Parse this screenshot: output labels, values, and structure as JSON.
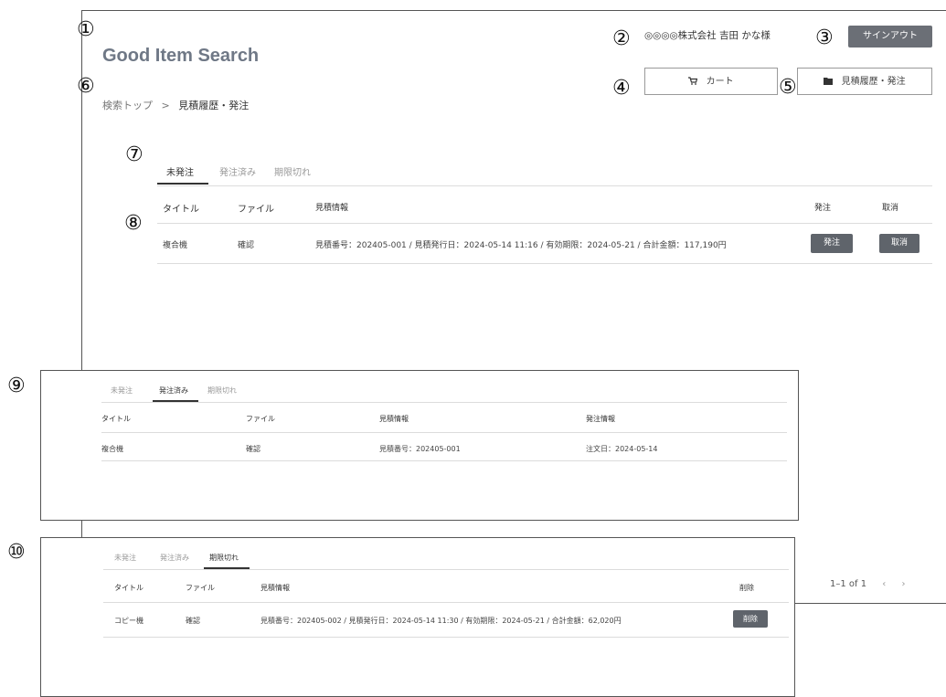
{
  "markers": [
    "①",
    "②",
    "③",
    "④",
    "⑤",
    "⑥",
    "⑦",
    "⑧",
    "⑨",
    "⑩"
  ],
  "header": {
    "title": "Good Item Search",
    "user_label": "◎◎◎◎株式会社 吉田 かな様",
    "signout_label": "サインアウト",
    "cart_label": "カート",
    "history_label": "見積履歴・発注"
  },
  "breadcrumb": {
    "home": "検索トップ",
    "separator": ">",
    "current": "見積履歴・発注"
  },
  "tabs": [
    "未発注",
    "発注済み",
    "期限切れ"
  ],
  "unordered_table": {
    "headers": [
      "タイトル",
      "ファイル",
      "見積情報",
      "発注",
      "取消"
    ],
    "rows": [
      {
        "title": "複合機",
        "file": "確認",
        "info": "見積番号：202405-001 / 見積発行日：2024-05-14 11:16 / 有効期限：2024-05-21 / 合計金額：117,190円",
        "order_btn": "発注",
        "cancel_btn": "取消"
      }
    ]
  },
  "ordered_table": {
    "headers": [
      "タイトル",
      "ファイル",
      "見積情報",
      "発注情報"
    ],
    "rows": [
      {
        "title": "複合機",
        "file": "確認",
        "info": "見積番号：202405-001",
        "order_info": "注文日：2024-05-14"
      }
    ]
  },
  "expired_table": {
    "headers": [
      "タイトル",
      "ファイル",
      "見積情報",
      "削除"
    ],
    "rows": [
      {
        "title": "コピー機",
        "file": "確認",
        "info": "見積番号：202405-002 / 見積発行日：2024-05-14 11:30 / 有効期限：2024-05-21 / 合計金額：62,020円",
        "delete_btn": "削除"
      }
    ]
  },
  "pager": {
    "range": "1–1 of 1",
    "prev": "‹",
    "next": "›"
  }
}
